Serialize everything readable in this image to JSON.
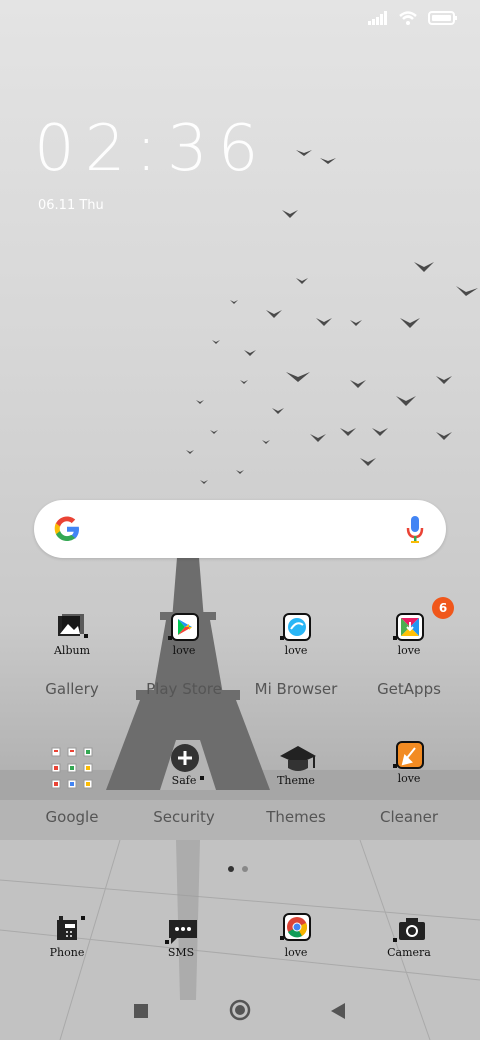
{
  "status": {
    "icons": [
      "signal-icon",
      "wifi-icon",
      "battery-icon"
    ]
  },
  "lockscreen": {
    "time": "02:36",
    "date": "06.11 Thu"
  },
  "search_bar": {
    "logo": "google-g-icon",
    "mic": "mic-icon"
  },
  "apps_row1": [
    {
      "label": "Gallery",
      "sub": "Album",
      "icon": "gallery-icon"
    },
    {
      "label": "Play Store",
      "sub": "love",
      "icon": "play-store-icon"
    },
    {
      "label": "Mi Browser",
      "sub": "love",
      "icon": "browser-icon"
    },
    {
      "label": "GetApps",
      "sub": "love",
      "icon": "getapps-icon",
      "badge": "6"
    }
  ],
  "apps_row2": [
    {
      "label": "Google",
      "sub": "",
      "icon": "google-folder-icon"
    },
    {
      "label": "Security",
      "sub": "Safe",
      "icon": "security-icon"
    },
    {
      "label": "Themes",
      "sub": "Theme",
      "icon": "themes-icon"
    },
    {
      "label": "Cleaner",
      "sub": "love",
      "icon": "cleaner-icon"
    }
  ],
  "page_indicator": {
    "pages": 2,
    "current": 1
  },
  "dock": [
    {
      "sub": "Phone",
      "icon": "phone-icon"
    },
    {
      "sub": "SMS",
      "icon": "sms-icon"
    },
    {
      "sub": "love",
      "icon": "chrome-icon"
    },
    {
      "sub": "Camera",
      "icon": "camera-icon"
    }
  ],
  "navbar": [
    "recents-button",
    "home-button",
    "back-button"
  ],
  "colors": {
    "badge": "#f0571b",
    "label": "#555555",
    "clock": "#ffffff"
  }
}
